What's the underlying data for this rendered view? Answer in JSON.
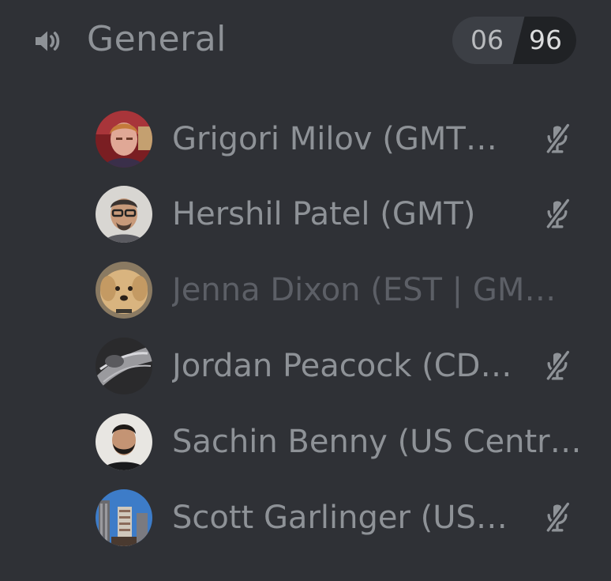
{
  "channel": {
    "name": "General",
    "icon": "speaker-icon",
    "user_count": "06",
    "user_limit": "96"
  },
  "users": [
    {
      "name": "Grigori Milov (GMT…",
      "muted": true,
      "avatar": "photo-man-red-background"
    },
    {
      "name": "Hershil Patel (GMT)",
      "muted": true,
      "avatar": "photo-man-glasses"
    },
    {
      "name": "Jenna Dixon (EST | GM…",
      "muted": false,
      "avatar": "photo-dog"
    },
    {
      "name": "Jordan Peacock (CD…",
      "muted": true,
      "avatar": "photo-dark-abstract"
    },
    {
      "name": "Sachin Benny (US Centr…",
      "muted": false,
      "avatar": "photo-man-beard"
    },
    {
      "name": "Scott Garlinger (US…",
      "muted": true,
      "avatar": "photo-buildings"
    }
  ],
  "colors": {
    "background": "#2f3136",
    "text": "#8e9297",
    "idle_text": "#5c5f66",
    "icon": "#8e9297"
  }
}
